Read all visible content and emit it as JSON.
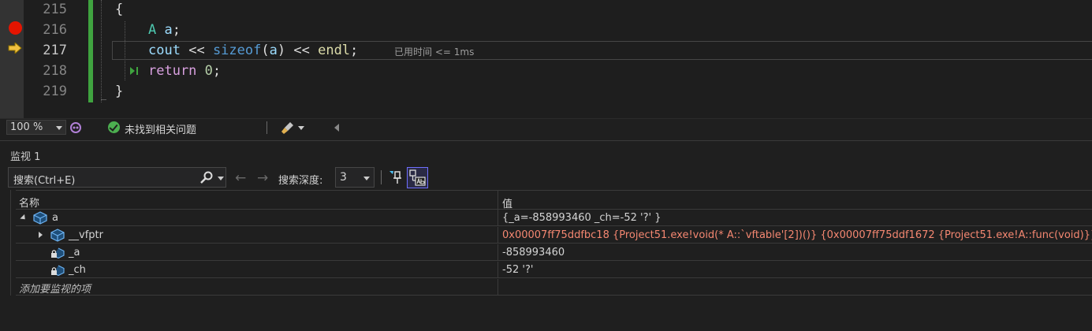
{
  "editor": {
    "lines": [
      {
        "num": "215",
        "brace": "{"
      },
      {
        "num": "216"
      },
      {
        "num": "217"
      },
      {
        "num": "218"
      },
      {
        "num": "219",
        "brace": "}"
      }
    ],
    "code": {
      "l216": {
        "type": "A",
        "var": "a",
        "semi": ";"
      },
      "l217": {
        "cout": "cout",
        "op1": "<<",
        "sizeof": "sizeof",
        "paren_open": "(",
        "arg": "a",
        "paren_close": ")",
        "op2": "<<",
        "endl": "endl",
        "semi": ";"
      },
      "l218": {
        "ret": "return",
        "zero": "0",
        "semi": ";"
      }
    },
    "perf_tip": "已用时间 <= 1ms",
    "colors": {
      "breakpoint": "#e51400",
      "current_arrow": "#f0c040",
      "change_bar": "#3fa33f"
    }
  },
  "status": {
    "zoom": "100 %",
    "issues": "未找到相关问题"
  },
  "watch": {
    "title": "监视 1",
    "search_placeholder": "搜索(Ctrl+E)",
    "depth_label": "搜索深度:",
    "depth_value": "3",
    "columns": {
      "name": "名称",
      "value": "值"
    },
    "rows": [
      {
        "name": "a",
        "value": "{_a=-858993460 _ch=-52 '?' }"
      },
      {
        "name": "__vfptr",
        "value": "0x00007ff75ddfbc18 {Project51.exe!void(* A::`vftable'[2])()} {0x00007ff75ddf1672 {Project51.exe!A::func(void)}}"
      },
      {
        "name": "_a",
        "value": "-858993460"
      },
      {
        "name": "_ch",
        "value": "-52 '?'"
      }
    ],
    "add_item": "添加要监视的项"
  }
}
